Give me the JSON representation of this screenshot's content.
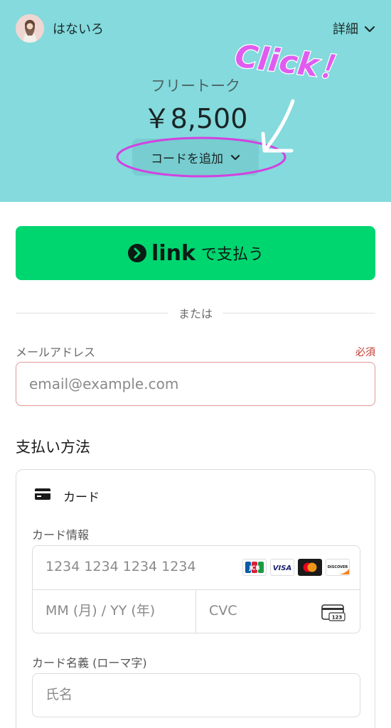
{
  "header": {
    "merchant_name": "はないろ",
    "details_label": "詳細",
    "product_name": "フリートーク",
    "price": "￥8,500",
    "add_code_label": "コードを追加",
    "annotation_text": "Click！",
    "background_color": "#84dadd"
  },
  "link_button": {
    "logo_text": "link",
    "label": "で支払う",
    "color": "#00d66f"
  },
  "divider": {
    "label": "または"
  },
  "email": {
    "label": "メールアドレス",
    "required_label": "必須",
    "placeholder": "email@example.com"
  },
  "payment": {
    "title": "支払い方法",
    "method_label": "カード",
    "card_info_label": "カード情報",
    "card_number_placeholder": "1234 1234 1234 1234",
    "expiry_placeholder": "MM (月) / YY (年)",
    "cvc_placeholder": "CVC",
    "cvc_icon_text": "123",
    "brands": [
      {
        "name": "JCB"
      },
      {
        "name": "VISA"
      },
      {
        "name": "Mastercard"
      },
      {
        "name": "DISCOVER"
      }
    ],
    "cardholder_label": "カード名義 (ローマ字)",
    "cardholder_placeholder": "氏名"
  }
}
